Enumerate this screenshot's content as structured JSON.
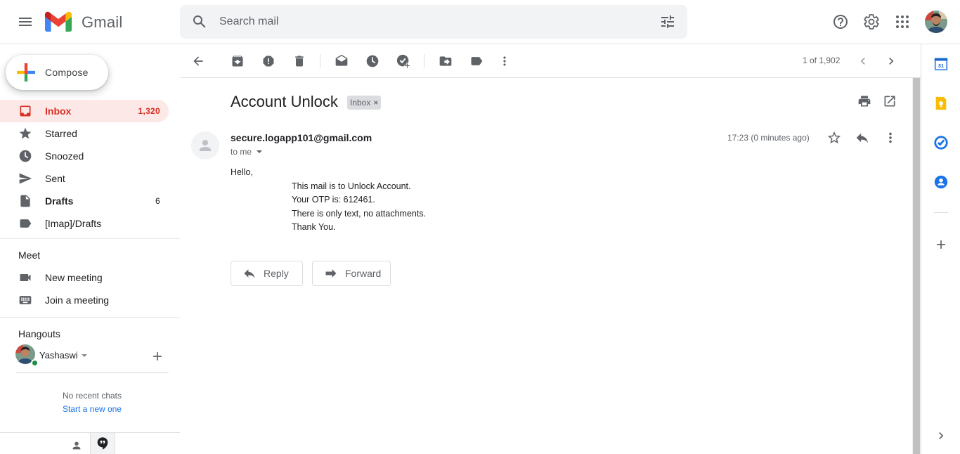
{
  "header": {
    "brand": "Gmail",
    "search_placeholder": "Search mail"
  },
  "compose": {
    "label": "Compose"
  },
  "nav": {
    "items": [
      {
        "label": "Inbox",
        "count": "1,320",
        "icon": "inbox-icon"
      },
      {
        "label": "Starred",
        "count": "",
        "icon": "star-icon"
      },
      {
        "label": "Snoozed",
        "count": "",
        "icon": "clock-icon"
      },
      {
        "label": "Sent",
        "count": "",
        "icon": "send-icon"
      },
      {
        "label": "Drafts",
        "count": "6",
        "icon": "draft-icon"
      },
      {
        "label": "[Imap]/Drafts",
        "count": "",
        "icon": "label-icon"
      }
    ]
  },
  "meet": {
    "title": "Meet",
    "new_meeting": "New meeting",
    "join_meeting": "Join a meeting"
  },
  "hangouts": {
    "title": "Hangouts",
    "user": "Yashaswi",
    "no_chats": "No recent chats",
    "start_new": "Start a new one"
  },
  "toolbar": {
    "pager": "1 of 1,902"
  },
  "message": {
    "subject": "Account Unlock",
    "label": "Inbox",
    "sender": "secure.logapp101@gmail.com",
    "to": "to me",
    "time": "17:23 (0 minutes ago)",
    "greeting": "Hello,",
    "body_lines": [
      "This mail is to Unlock Account.",
      "Your OTP is: 612461.",
      "There is only text, no attachments.",
      "Thank You."
    ]
  },
  "actions": {
    "reply": "Reply",
    "forward": "Forward"
  },
  "colors": {
    "accent_red": "#d93025",
    "active_bg": "#fce8e6",
    "link_blue": "#1a73e8",
    "online_green": "#1e8e3e"
  }
}
